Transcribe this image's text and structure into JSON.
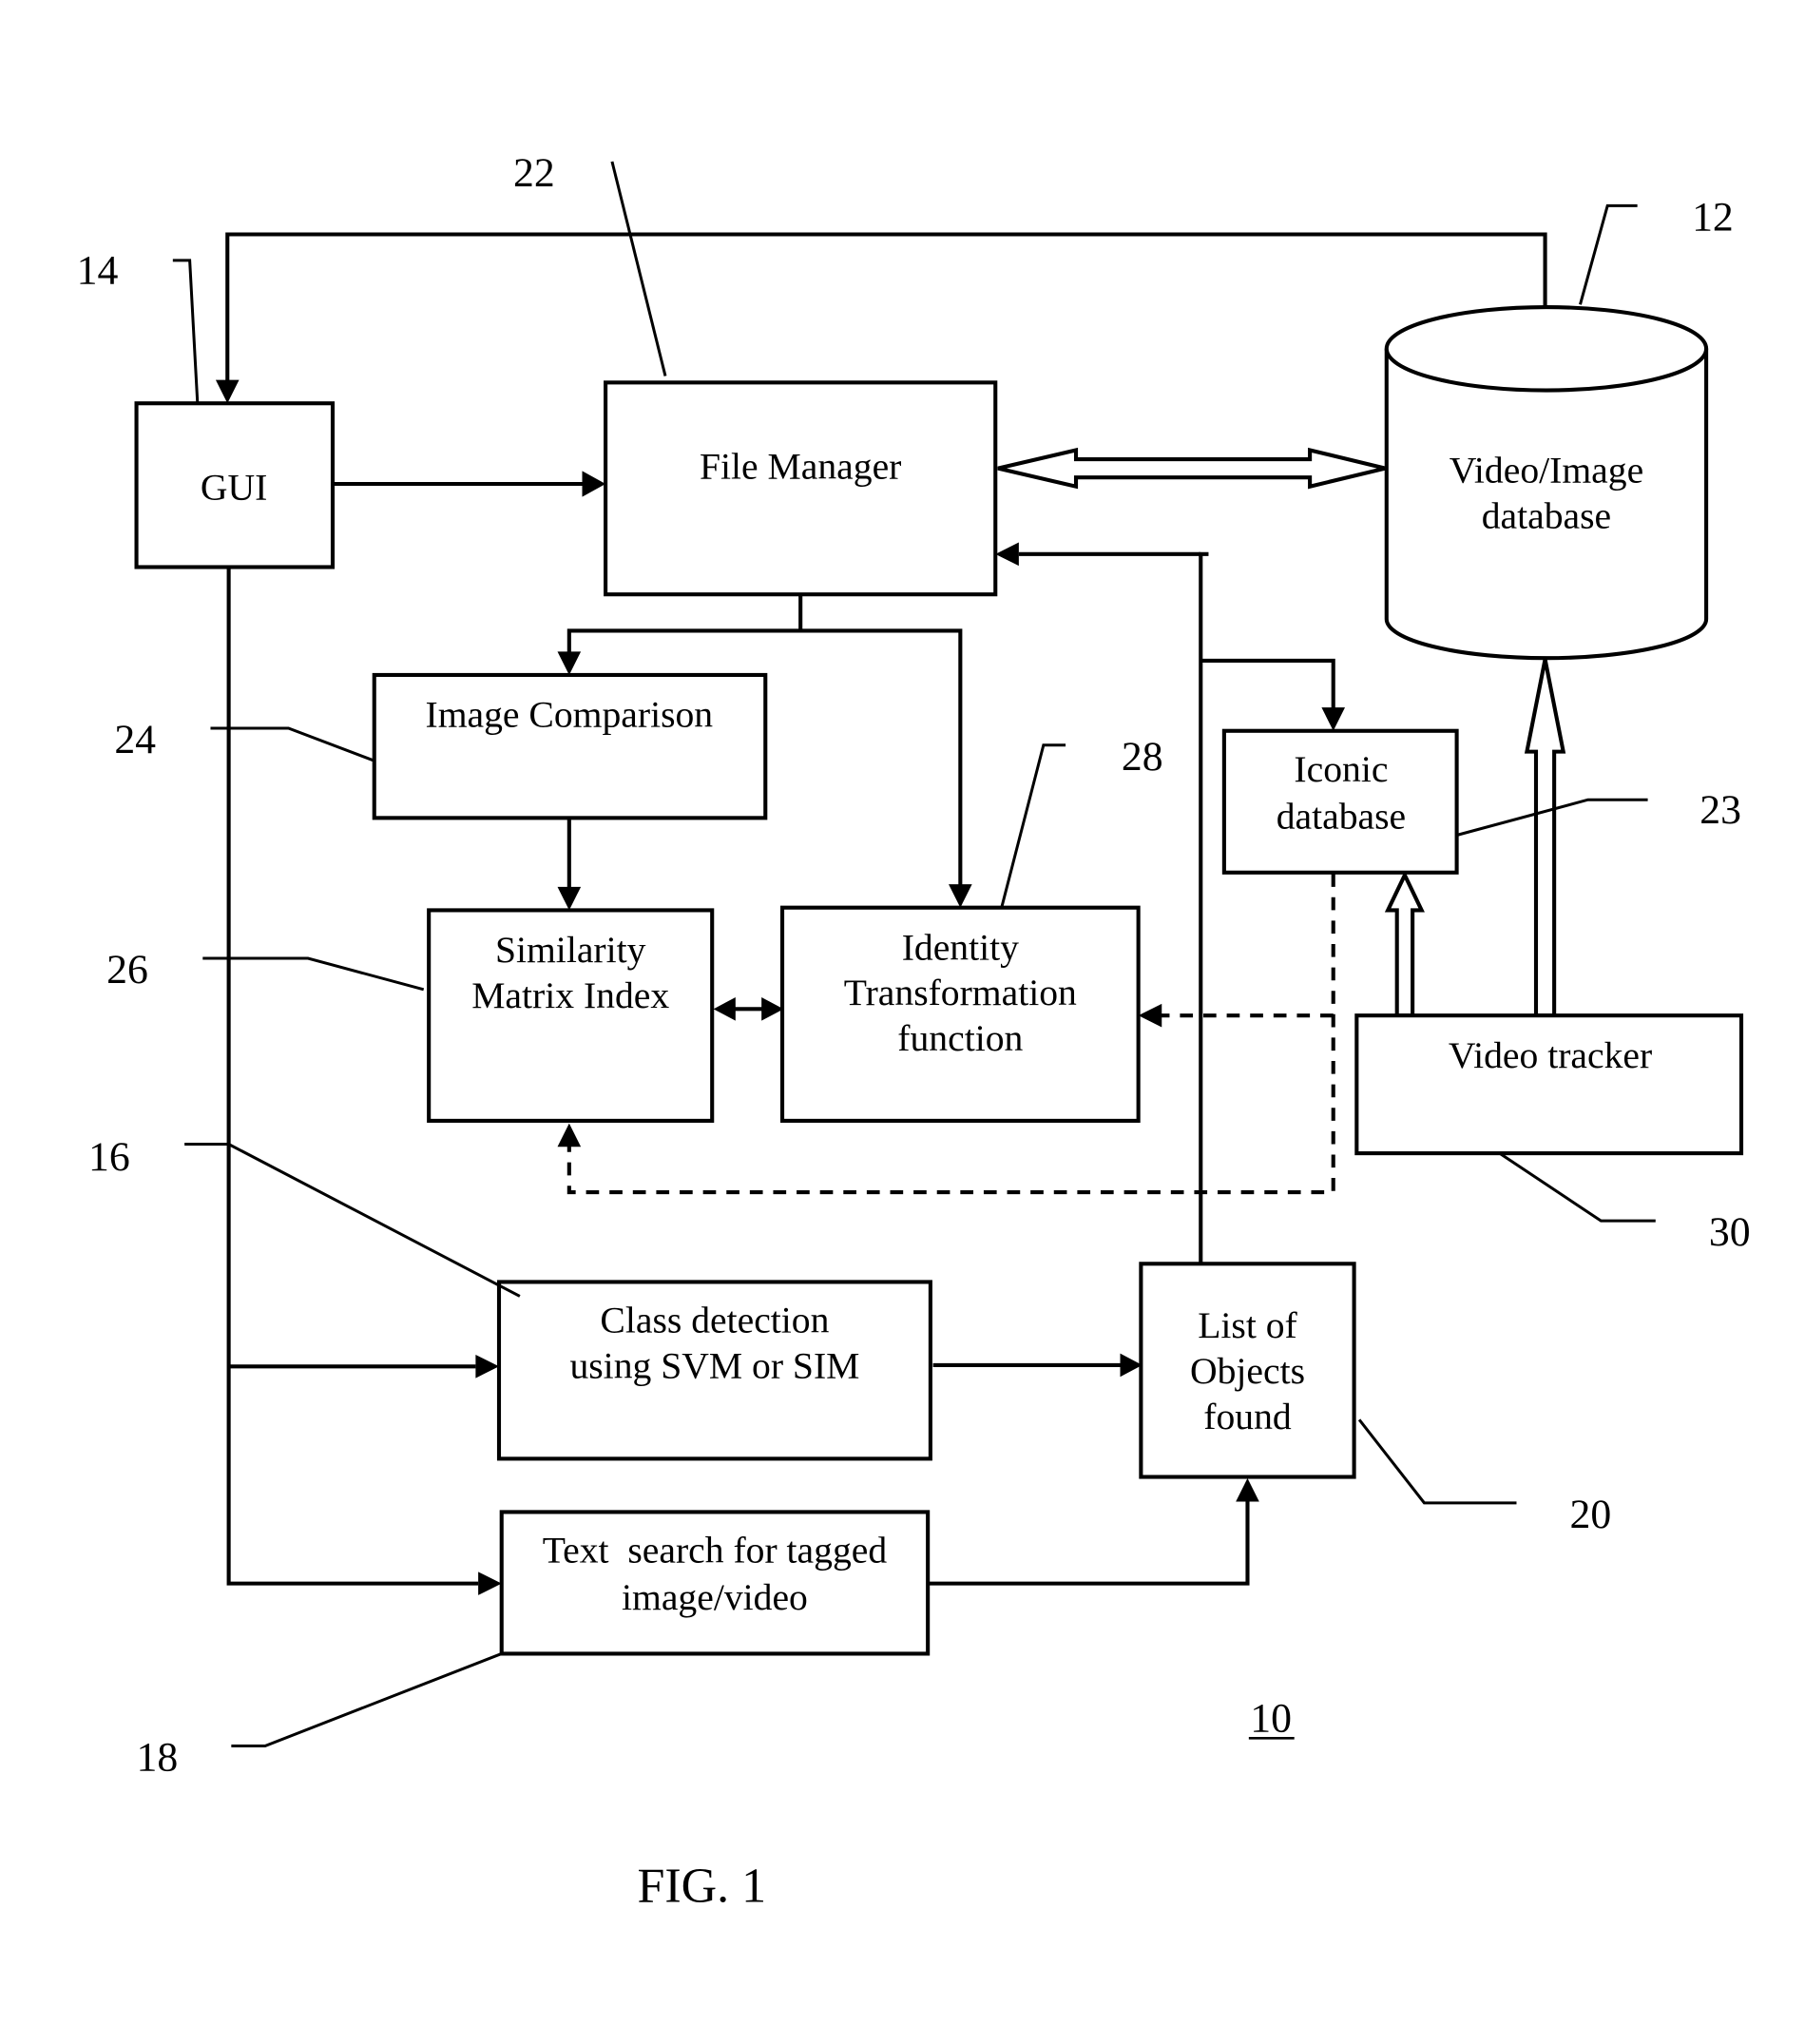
{
  "figure": {
    "caption": "FIG. 1",
    "system_ref": "10"
  },
  "blocks": {
    "gui": {
      "label": "GUI",
      "ref": "14"
    },
    "file_manager": {
      "label": "File Manager",
      "ref": "22"
    },
    "video_image_db": {
      "lines": [
        "Video/Image",
        "database"
      ],
      "ref": "12"
    },
    "image_comparison": {
      "label": "Image Comparison",
      "ref": "24"
    },
    "similarity_matrix": {
      "lines": [
        "Similarity",
        "Matrix Index"
      ],
      "ref": "26"
    },
    "identity_transformation": {
      "lines": [
        "Identity",
        "Transformation",
        "function"
      ],
      "ref": "28"
    },
    "iconic_db": {
      "lines": [
        "Iconic",
        "database"
      ],
      "ref": "23"
    },
    "video_tracker": {
      "label": "Video tracker",
      "ref": "30"
    },
    "class_detection": {
      "lines": [
        "Class detection",
        "using SVM or SIM"
      ],
      "ref": "16"
    },
    "list_of_objects": {
      "lines": [
        "List of",
        "Objects",
        "found"
      ],
      "ref": "20"
    },
    "text_search": {
      "lines": [
        "Text  search for tagged",
        "image/video"
      ],
      "ref": "18"
    }
  }
}
